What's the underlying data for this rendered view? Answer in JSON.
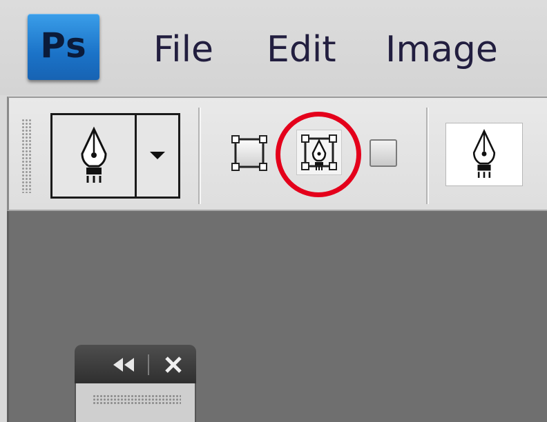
{
  "app": {
    "logo_text": "Ps",
    "brand_color": "#1b73c8"
  },
  "menu": {
    "items": [
      {
        "label": "File"
      },
      {
        "label": "Edit"
      },
      {
        "label": "Image"
      }
    ]
  },
  "options_bar": {
    "tool_preset_icon": "pen-tool-icon",
    "path_modes": [
      {
        "icon": "shape-layers-icon",
        "selected": false
      },
      {
        "icon": "paths-icon",
        "selected": true
      },
      {
        "icon": "fill-pixels-icon",
        "selected": false
      }
    ],
    "highlight_color": "#e4001b"
  },
  "panel": {
    "collapse_icon": "double-chevron-left-icon",
    "close_icon": "close-icon"
  }
}
